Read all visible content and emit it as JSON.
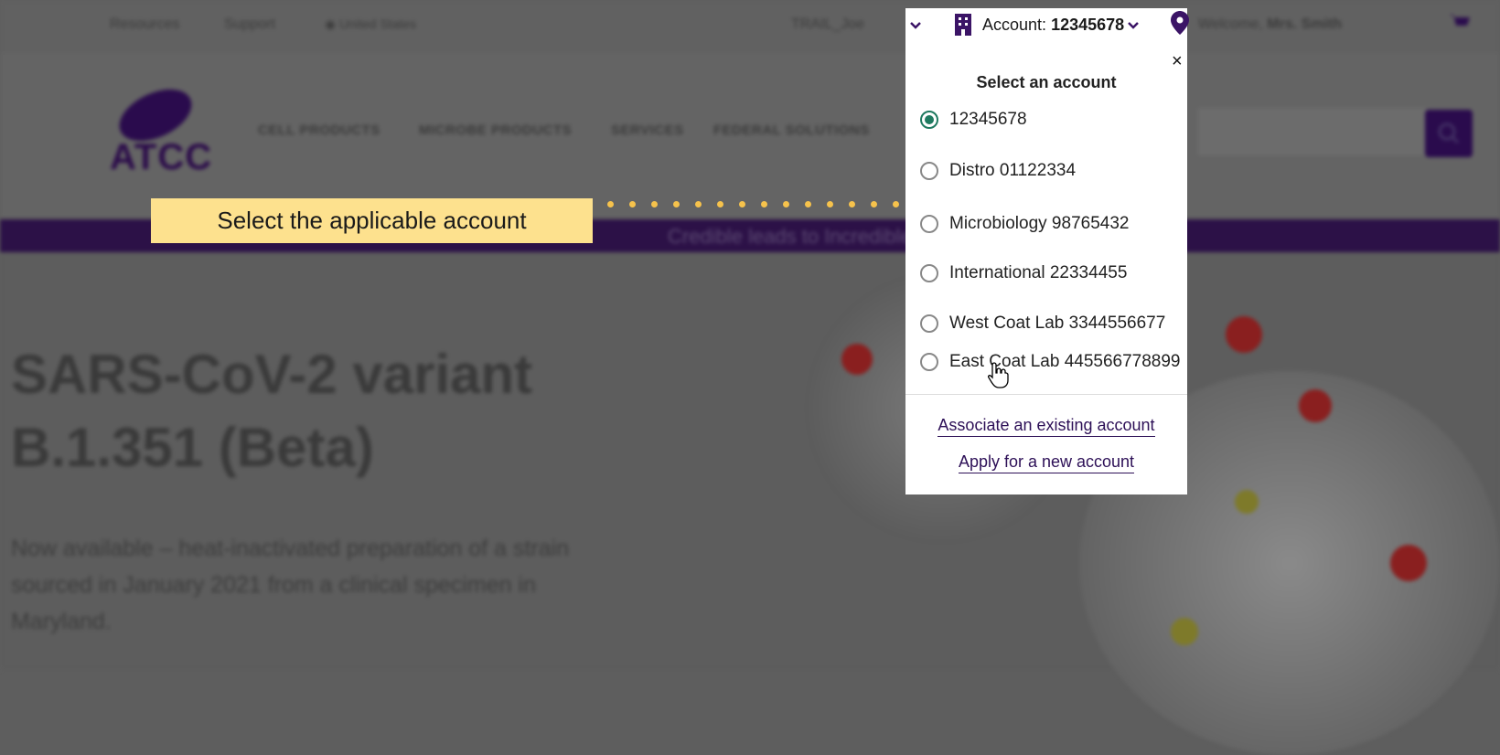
{
  "topbar": {
    "resources": "Resources",
    "support": "Support",
    "region": "United States",
    "cart_label": "TRAIL_Joe",
    "welcome": "Welcome,",
    "user": "Mrs. Smith"
  },
  "nav": {
    "items": [
      "CELL PRODUCTS",
      "MICROBE PRODUCTS",
      "SERVICES",
      "FEDERAL SOLUTIONS"
    ],
    "logo": "ATCC"
  },
  "banner": {
    "text": "Credible leads to Incredible"
  },
  "hero": {
    "title": "SARS-CoV-2 variant B.1.351 (Beta)",
    "description": "Now available – heat-inactivated preparation of a strain sourced in January 2021 from a clinical specimen in Maryland."
  },
  "callout": {
    "text": "Select the applicable account"
  },
  "account": {
    "prefix": "Account:",
    "number": "12345678"
  },
  "dropdown": {
    "close": "×",
    "title": "Select an account",
    "options": [
      {
        "label": "12345678",
        "selected": true
      },
      {
        "label": "Distro 01122334",
        "selected": false
      },
      {
        "label": "Microbiology 98765432",
        "selected": false
      },
      {
        "label": "International 22334455",
        "selected": false
      },
      {
        "label": "West Coat Lab 3344556677",
        "selected": false
      },
      {
        "label": "East Coat Lab 445566778899",
        "selected": false
      }
    ],
    "associate_link": "Associate an existing account",
    "apply_link": "Apply for a new account"
  },
  "colors": {
    "brand_purple": "#2d1057",
    "radio_selected": "#1f7a60",
    "callout_bg": "#fde18e",
    "callout_dots": "#f6c24c"
  },
  "icons": [
    "building-icon",
    "chevron-down-icon",
    "location-pin-icon",
    "cart-icon",
    "search-icon",
    "close-icon",
    "hand-cursor-icon"
  ]
}
